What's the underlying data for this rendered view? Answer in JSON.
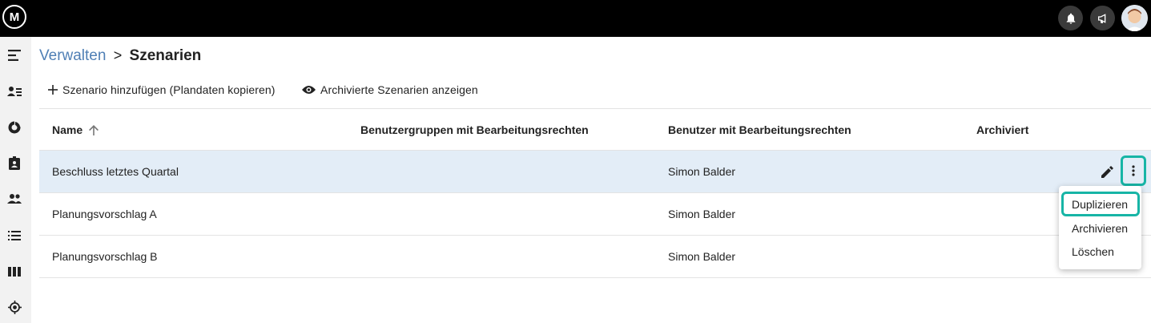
{
  "topbar": {
    "logo_text": "M",
    "icons": [
      "bell-icon",
      "megaphone-icon"
    ],
    "avatar": "user-avatar"
  },
  "sidebar": {
    "icons": [
      "menu-collapse-icon",
      "contacts-icon",
      "chart-donut-icon",
      "badge-icon",
      "group-icon",
      "list-icon",
      "columns-icon",
      "target-icon"
    ]
  },
  "breadcrumb": {
    "parent": "Verwalten",
    "separator": ">",
    "current": "Szenarien"
  },
  "toolbar": {
    "add_label": "Szenario hinzufügen (Plandaten kopieren)",
    "show_archived_label": "Archivierte Szenarien anzeigen"
  },
  "table": {
    "headers": [
      "Name",
      "Benutzergruppen mit Bearbeitungsrechten",
      "Benutzer mit Bearbeitungsrechten",
      "Archiviert"
    ],
    "sort": {
      "column": "Name",
      "direction": "ascending"
    },
    "rows": [
      {
        "name": "Beschluss letztes Quartal",
        "groups": "",
        "users": "Simon Balder",
        "archived": ""
      },
      {
        "name": "Planungsvorschlag A",
        "groups": "",
        "users": "Simon Balder",
        "archived": ""
      },
      {
        "name": "Planungsvorschlag B",
        "groups": "",
        "users": "Simon Balder",
        "archived": ""
      }
    ]
  },
  "context_menu": {
    "items": [
      "Duplizieren",
      "Archivieren",
      "Löschen"
    ],
    "highlighted": "Duplizieren"
  },
  "colors": {
    "link": "#4f7fb5",
    "highlight": "#17b5a6",
    "selected_row": "#e3edf7"
  }
}
